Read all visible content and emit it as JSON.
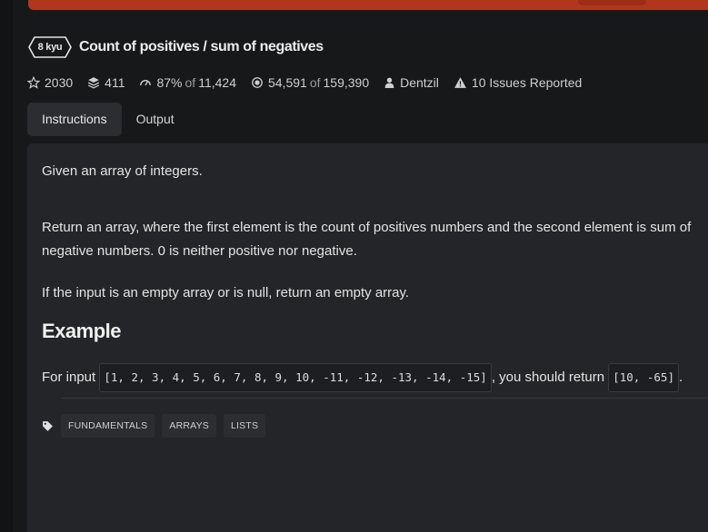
{
  "kata": {
    "rank": "8 kyu",
    "title": "Count of positives / sum of negatives"
  },
  "stats": {
    "stars": "2030",
    "collections": "411",
    "satisfaction_pct": "87%",
    "satisfaction_of": "of",
    "satisfaction_votes": "11,424",
    "completed": "54,591",
    "completed_of": "of",
    "attempts": "159,390",
    "author": "Dentzil",
    "issues": "10 Issues Reported"
  },
  "tabs": [
    {
      "label": "Instructions",
      "active": true
    },
    {
      "label": "Output",
      "active": false
    }
  ],
  "description": {
    "p1": "Given an array of integers.",
    "p2": "Return an array, where the first element is the count of positives numbers and the second element is sum of negative numbers. 0 is neither positive nor negative.",
    "p3": "If the input is an empty array or is null, return an empty array.",
    "example_heading": "Example",
    "example_prefix": "For input",
    "example_input": "[1, 2, 3, 4, 5, 6, 7, 8, 9, 10, -11, -12, -13, -14, -15]",
    "example_middle": ", you should return",
    "example_output": "[10, -65]",
    "example_suffix": "."
  },
  "tags": [
    "FUNDAMENTALS",
    "ARRAYS",
    "LISTS"
  ],
  "colors": {
    "banner": "#b1361e",
    "background": "#17181a",
    "panel": "#242528"
  }
}
